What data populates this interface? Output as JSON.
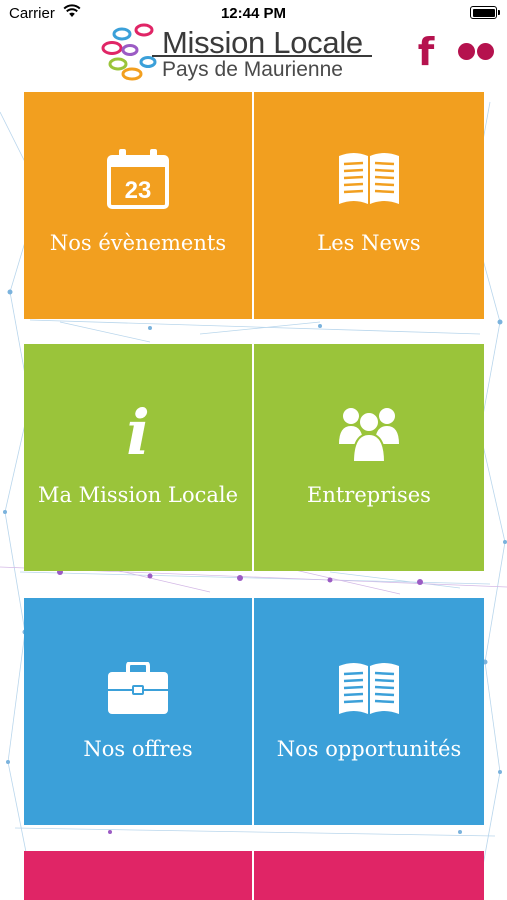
{
  "status_bar": {
    "carrier": "Carrier",
    "time": "12:44 PM"
  },
  "header": {
    "logo_title": "Mission Locale",
    "logo_subtitle": "Pays de Maurienne",
    "facebook_glyph": "f",
    "brand_color": "#b5124e"
  },
  "tiles": [
    {
      "label": "Nos évènements",
      "icon": "calendar-icon",
      "calendar_day": "23",
      "color": "#f29f1f"
    },
    {
      "label": "Les News",
      "icon": "open-book-icon",
      "color": "#f29f1f"
    },
    {
      "label": "Ma Mission Locale",
      "icon": "info-icon",
      "icon_glyph": "i",
      "color": "#9ac43a"
    },
    {
      "label": "Entreprises",
      "icon": "people-group-icon",
      "color": "#9ac43a"
    },
    {
      "label": "Nos offres",
      "icon": "briefcase-icon",
      "color": "#3ba0d9"
    },
    {
      "label": "Nos opportunités",
      "icon": "open-book-icon",
      "color": "#3ba0d9"
    },
    {
      "label": "",
      "icon": "",
      "color": "#e02566"
    },
    {
      "label": "",
      "icon": "",
      "color": "#e02566"
    }
  ]
}
